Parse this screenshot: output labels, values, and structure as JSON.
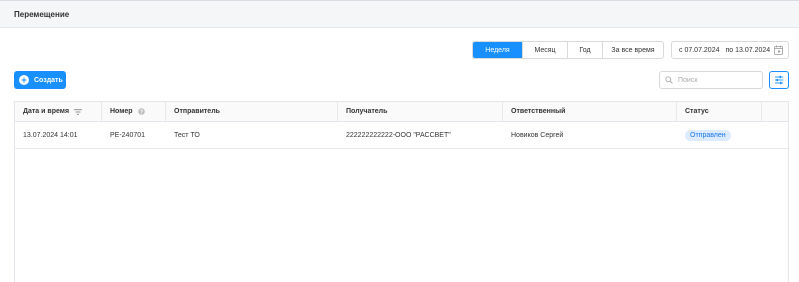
{
  "header": {
    "title": "Перемещение"
  },
  "period_tabs": [
    {
      "label": "Неделя",
      "active": true
    },
    {
      "label": "Месяц",
      "active": false
    },
    {
      "label": "Год",
      "active": false
    },
    {
      "label": "За все время",
      "active": false
    }
  ],
  "date_range": {
    "from": "с 07.07.2024",
    "to": "по 13.07.2024"
  },
  "toolbar": {
    "create_label": "Создать",
    "search_placeholder": "Поиск"
  },
  "table": {
    "columns": [
      "Дата и время",
      "Номер",
      "Отправитель",
      "Получатель",
      "Ответственный",
      "Статус"
    ],
    "rows": [
      {
        "datetime": "13.07.2024 14:01",
        "number": "PE-240701",
        "sender": "Тест ТО",
        "recipient": "222222222222-ООО \"РАССВЕТ\"",
        "responsible": "Новиков Сергей",
        "status": "Отправлен"
      }
    ]
  },
  "colors": {
    "accent": "#1890ff",
    "badge_bg": "#dcebff",
    "badge_text": "#1677e6"
  }
}
